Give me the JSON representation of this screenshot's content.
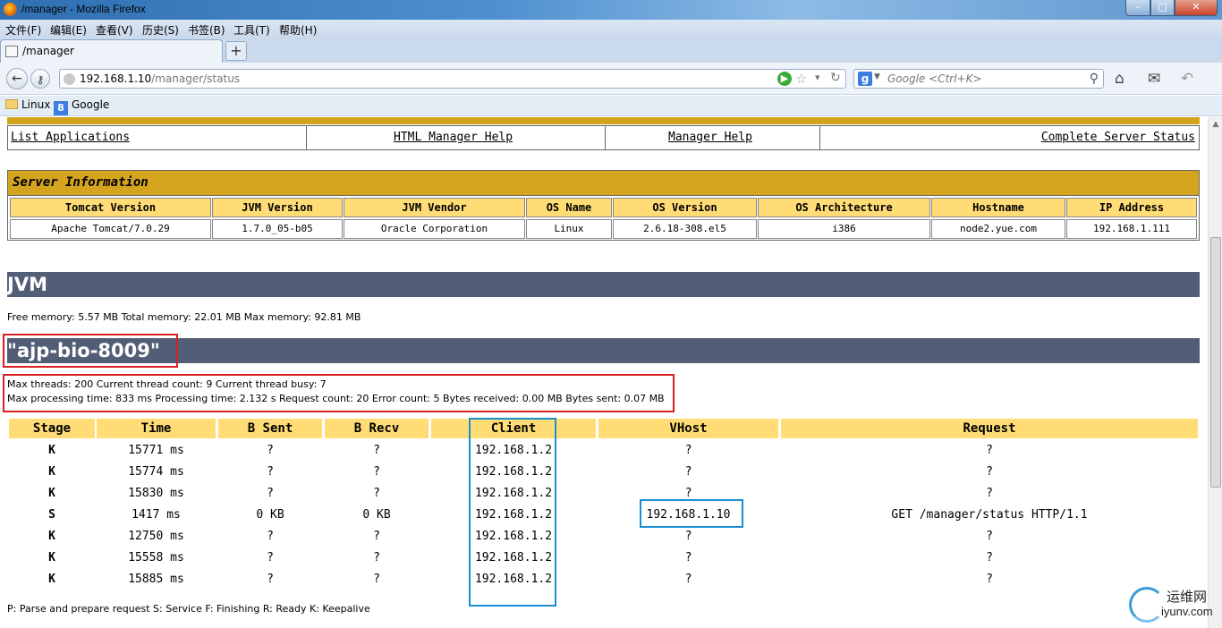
{
  "window": {
    "title": "/manager - Mozilla Firefox",
    "min_symbol": "–",
    "max_symbol": "□",
    "close_symbol": "✕"
  },
  "menu": [
    "文件(F)",
    "编辑(E)",
    "查看(V)",
    "历史(S)",
    "书签(B)",
    "工具(T)",
    "帮助(H)"
  ],
  "tabs": {
    "active_label": "/manager",
    "new_tab_symbol": "+"
  },
  "nav": {
    "back_symbol": "←",
    "url_host": "192.168.1.10",
    "url_path": "/manager/status",
    "search_placeholder": "Google <Ctrl+K>",
    "search_engine_letter": "g"
  },
  "bookmarks": [
    {
      "label": "Linux",
      "icon": "folder-icon"
    },
    {
      "label": "Google",
      "icon": "google-icon"
    }
  ],
  "manager_nav": {
    "list_applications": "List Applications",
    "html_manager_help": "HTML Manager Help",
    "manager_help": "Manager Help",
    "complete_server_status": "Complete Server Status"
  },
  "server_info": {
    "title": "Server Information",
    "headers": [
      "Tomcat Version",
      "JVM Version",
      "JVM Vendor",
      "OS Name",
      "OS Version",
      "OS Architecture",
      "Hostname",
      "IP Address"
    ],
    "values": [
      "Apache Tomcat/7.0.29",
      "1.7.0_05-b05",
      "Oracle Corporation",
      "Linux",
      "2.6.18-308.el5",
      "i386",
      "node2.yue.com",
      "192.168.1.111"
    ]
  },
  "jvm": {
    "heading": "JVM",
    "memory": "Free memory: 5.57 MB Total memory: 22.01 MB Max memory: 92.81 MB"
  },
  "connector": {
    "heading": "\"ajp-bio-8009\"",
    "threads": "Max threads: 200 Current thread count: 9 Current thread busy: 7",
    "processing": "Max processing time: 833 ms Processing time: 2.132 s Request count: 20 Error count: 5 Bytes received: 0.00 MB Bytes sent: 0.07 MB"
  },
  "workers": {
    "headers": [
      "Stage",
      "Time",
      "B Sent",
      "B Recv",
      "Client",
      "VHost",
      "Request"
    ],
    "rows": [
      [
        "K",
        "15771 ms",
        "?",
        "?",
        "192.168.1.2",
        "?",
        "?"
      ],
      [
        "K",
        "15774 ms",
        "?",
        "?",
        "192.168.1.2",
        "?",
        "?"
      ],
      [
        "K",
        "15830 ms",
        "?",
        "?",
        "192.168.1.2",
        "?",
        "?"
      ],
      [
        "S",
        "1417 ms",
        "0 KB",
        "0 KB",
        "192.168.1.2",
        "192.168.1.10",
        "GET /manager/status HTTP/1.1"
      ],
      [
        "K",
        "12750 ms",
        "?",
        "?",
        "192.168.1.2",
        "?",
        "?"
      ],
      [
        "K",
        "15558 ms",
        "?",
        "?",
        "192.168.1.2",
        "?",
        "?"
      ],
      [
        "K",
        "15885 ms",
        "?",
        "?",
        "192.168.1.2",
        "?",
        "?"
      ]
    ],
    "legend": "P: Parse and prepare request S: Service F: Finishing R: Ready K: Keepalive"
  },
  "watermark": {
    "cn": "运维网",
    "en": "iyunv.com"
  },
  "colors": {
    "gold": "#d4a41f",
    "header_yellow": "#ffdc75",
    "section_slate": "#525d76",
    "annotation_red": "#d42020",
    "annotation_blue": "#1a8fd0"
  }
}
